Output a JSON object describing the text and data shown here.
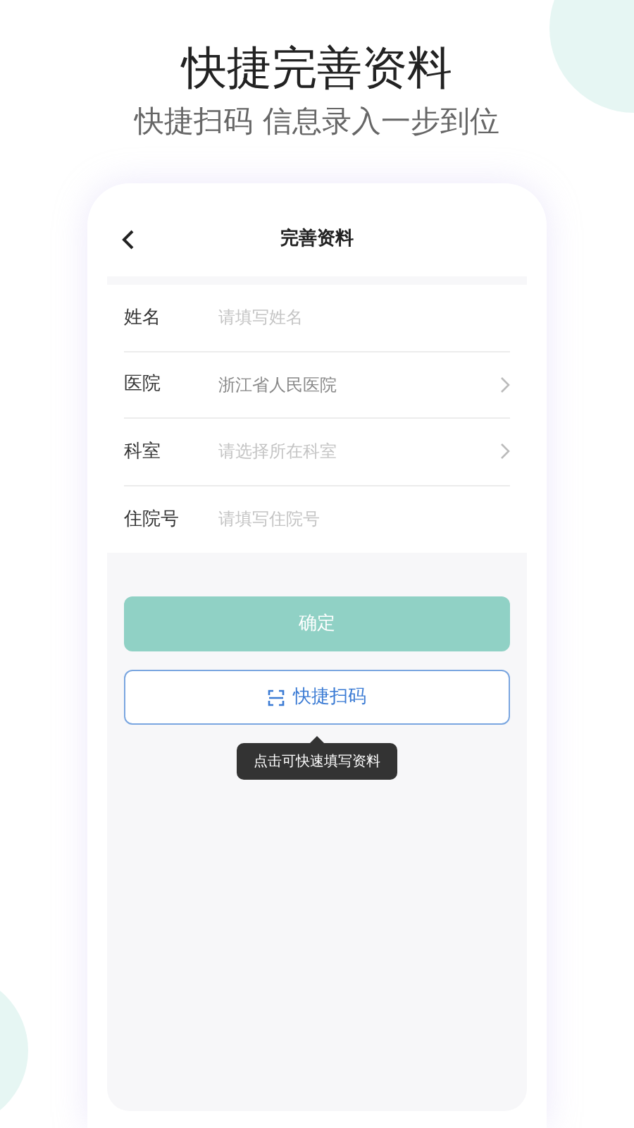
{
  "headline": "快捷完善资料",
  "subheadline": "快捷扫码 信息录入一步到位",
  "screen": {
    "nav_title": "完善资料",
    "fields": [
      {
        "kind": "input",
        "label": "姓名",
        "placeholder": "请填写姓名"
      },
      {
        "kind": "select",
        "label": "医院",
        "value": "浙江省人民医院"
      },
      {
        "kind": "select",
        "label": "科室",
        "placeholder": "请选择所在科室"
      },
      {
        "kind": "input",
        "label": "住院号",
        "placeholder": "请填写住院号"
      }
    ],
    "confirm_button": {
      "label": "确定",
      "disabled": true
    },
    "scan_button": {
      "label": "快捷扫码"
    },
    "tooltip": "点击可快速填写资料"
  }
}
